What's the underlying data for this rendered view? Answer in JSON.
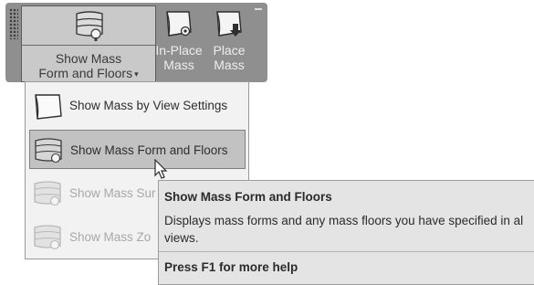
{
  "ribbon": {
    "show_mass_button": {
      "line1": "Show Mass",
      "line2": "Form and Floors",
      "caret": "▾"
    },
    "in_place_mass": {
      "line1": "In-Place",
      "line2": "Mass"
    },
    "place_mass": {
      "line1": "Place",
      "line2": "Mass"
    }
  },
  "dropdown": {
    "items": [
      {
        "label": "Show Mass  by View Settings",
        "state": "normal"
      },
      {
        "label": "Show Mass  Form and Floors",
        "state": "highlighted"
      },
      {
        "label": "Show Mass  Sur",
        "state": "disabled"
      },
      {
        "label": "Show Mass  Zo",
        "state": "disabled"
      }
    ]
  },
  "tooltip": {
    "title": "Show Mass Form and Floors",
    "description": "Displays mass forms and any mass floors you have specified in al views.",
    "help": "Press F1 for more help"
  },
  "colors": {
    "panel_bg": "#8f8f8f",
    "button_bg": "#c9c9c9",
    "menu_bg": "#f2f2f2",
    "highlight": "#c2c2c2",
    "tooltip_bg": "#e4e4e4"
  }
}
